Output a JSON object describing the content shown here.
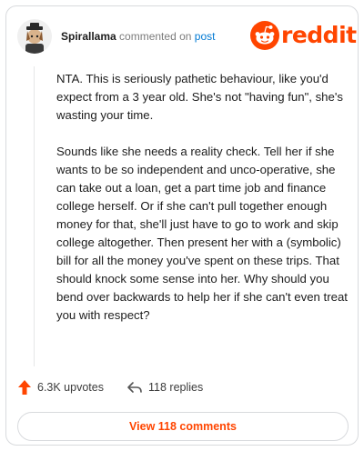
{
  "header": {
    "username": "Spirallama",
    "action_text": "commented on",
    "post_link": "post",
    "logo_text": "reddit"
  },
  "comment": {
    "paragraph_1": "NTA. This is seriously pathetic behaviour, like you'd expect from a 3 year old. She's not \"having fun\", she's wasting your time.",
    "paragraph_2": "Sounds like she needs a reality check. Tell her if she wants to be so independent and unco-operative, she can take out a loan, get a part time job and finance college herself. Or if she can't pull together enough money for that, she'll just have to go to work and skip college altogether. Then present her with a (symbolic) bill for all the money you've spent on these trips. That should knock some sense into her. Why should you bend over backwards to help her if she can't even treat you with respect?"
  },
  "footer": {
    "upvotes": "6.3K upvotes",
    "replies": "118 replies",
    "view_comments": "View 118 comments"
  },
  "colors": {
    "brand": "#ff4500",
    "link": "#0079d3",
    "text": "#1c1c1c",
    "muted": "#7c7c7c",
    "border": "#d8dadd"
  },
  "icons": [
    "user-avatar",
    "reddit-snoo-icon",
    "upvote-arrow-icon",
    "reply-arrow-icon"
  ]
}
